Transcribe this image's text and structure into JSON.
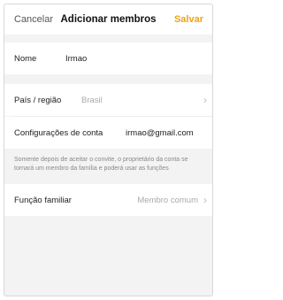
{
  "header": {
    "cancel_label": "Cancelar",
    "title": "Adicionar membros",
    "save_label": "Salvar",
    "accent_color": "#f2a115"
  },
  "name_row": {
    "label": "Nome",
    "value": "Irmao"
  },
  "country_row": {
    "label": "País / região",
    "value": "Brasil",
    "icon": "chevron-right-icon"
  },
  "account_row": {
    "label": "Configurações de conta",
    "value": "irmao@gmail.com"
  },
  "info_text": "Somente depois de aceitar o convite, o proprietário da conta se tornará um membro da família e poderá usar as funções",
  "role_row": {
    "label": "Função familiar",
    "value": "Membro comum",
    "icon": "chevron-right-icon"
  }
}
